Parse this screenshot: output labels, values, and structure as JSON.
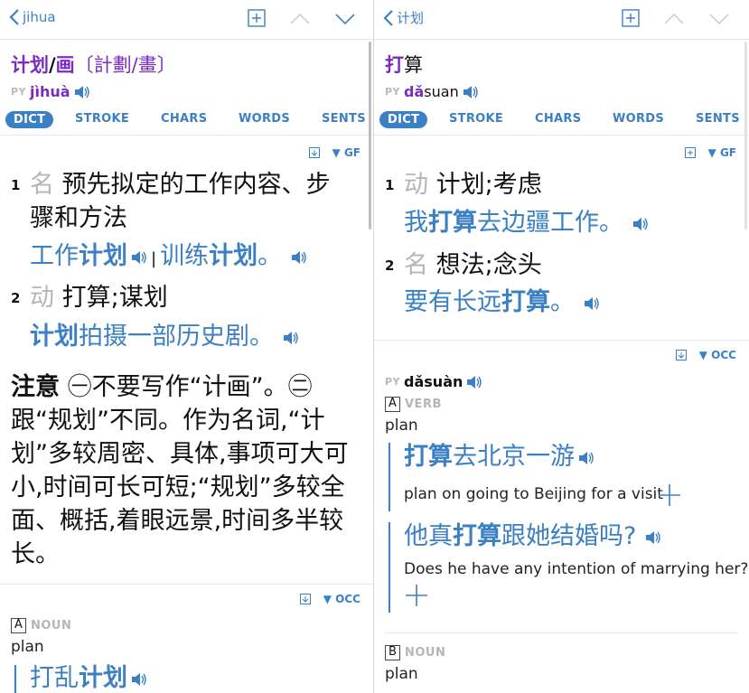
{
  "left": {
    "nav": {
      "back_label": "jihua"
    },
    "headword": {
      "simp1": "计划",
      "sep1": "/",
      "simp2": "画",
      "trad": "〔計劃/畫〕"
    },
    "pinyin": {
      "tag": "PY",
      "text": "jìhuà"
    },
    "tabs": [
      "DICT",
      "STROKE",
      "CHARS",
      "WORDS",
      "SENTS"
    ],
    "dict_source": "GF",
    "senses": [
      {
        "num": "1",
        "pos": "名",
        "def_line1": "预先拟定的工作内容、步",
        "def_line2": "骤和方法",
        "ex_a1": "工作",
        "ex_a2": "计划",
        "ex_sep": "|",
        "ex_b1": "训练",
        "ex_b2": "计划",
        "ex_end": "。"
      },
      {
        "num": "2",
        "pos": "动",
        "def": "打算;谋划",
        "ex_1": "计划",
        "ex_2": "拍摄一部历史剧。"
      }
    ],
    "note": {
      "label": "注意",
      "text": "㊀不要写作“计画”。㊁跟“规划”不同。作为名词,“计划”多较周密、具体,事项可大可小,时间可长可短;“规划”多较全面、概括,着眼远景,时间多半较长。"
    },
    "occ": {
      "source": "OCC",
      "letter": "A",
      "pos": "NOUN",
      "gloss": "plan",
      "ex_1": "打乱",
      "ex_2": "计划"
    }
  },
  "right": {
    "nav": {
      "back_label": "计划"
    },
    "headword": {
      "bold": "打",
      "rest": "算"
    },
    "pinyin": {
      "tag": "PY",
      "bold": "dǎ",
      "rest": "suan"
    },
    "tabs": [
      "DICT",
      "STROKE",
      "CHARS",
      "WORDS",
      "SENTS"
    ],
    "dict_source": "GF",
    "senses": [
      {
        "num": "1",
        "pos": "动",
        "def": "计划;考虑",
        "ex_1": "我",
        "ex_2": "打算",
        "ex_3": "去边疆工作。"
      },
      {
        "num": "2",
        "pos": "名",
        "def": "想法;念头",
        "ex_1": "要有长远",
        "ex_2": "打算",
        "ex_3": "。"
      }
    ],
    "occ": {
      "source": "OCC",
      "pinyin_tag": "PY",
      "pinyin": "dǎsuàn",
      "letter_a": "A",
      "pos_a": "VERB",
      "gloss_a": "plan",
      "examples": [
        {
          "zh_bold": "打算",
          "zh_rest": "去北京一游",
          "en": "plan on going to Beijing for a visit"
        },
        {
          "zh_pre": "他真",
          "zh_bold": "打算",
          "zh_rest": "跟她结婚吗?",
          "en": "Does he have any intention of marrying her?"
        }
      ],
      "letter_b": "B",
      "pos_b": "NOUN",
      "gloss_b": "plan"
    }
  },
  "colors": {
    "accent": "#3b7fc4",
    "headword": "#7b2bbf",
    "muted": "#b5b5b5"
  }
}
